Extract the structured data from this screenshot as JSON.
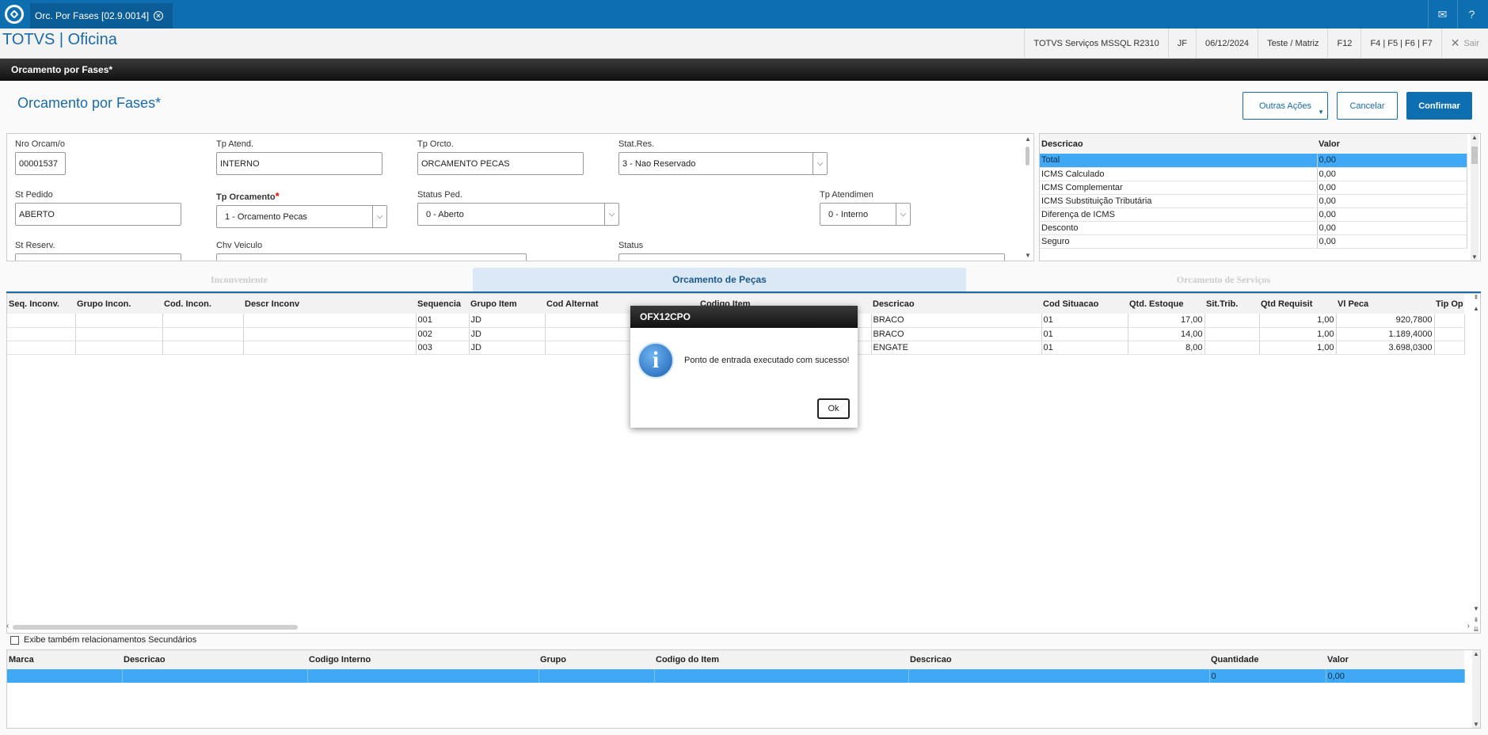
{
  "topbar": {
    "tab_label": "Orc. Por Fases [02.9.0014]",
    "icons": [
      "totvs-logo-icon",
      "close-tab-icon",
      "mail-icon",
      "help-icon"
    ]
  },
  "header": {
    "brand": "TOTVS | Oficina",
    "server": "TOTVS Serviços MSSQL R2310",
    "user": "JF",
    "date": "06/12/2024",
    "branch": "Teste / Matriz",
    "f12": "F12",
    "fkeys": "F4 | F5 | F6 | F7",
    "exit": "Sair"
  },
  "window": {
    "title": "Orcamento por Fases*"
  },
  "page": {
    "title": "Orcamento por Fases*"
  },
  "actions": {
    "other": "Outras Ações",
    "cancel": "Cancelar",
    "confirm": "Confirmar"
  },
  "form": {
    "nro_orcam": {
      "label": "Nro Orcam/o",
      "value": "00001537"
    },
    "tp_atend": {
      "label": "Tp Atend.",
      "value": "INTERNO"
    },
    "tp_orcto": {
      "label": "Tp Orcto.",
      "value": "ORCAMENTO PECAS"
    },
    "stat_res": {
      "label": "Stat.Res.",
      "value": "3 - Nao Reservado"
    },
    "st_pedido": {
      "label": "St Pedido",
      "value": "ABERTO"
    },
    "tp_orcamento": {
      "label": "Tp Orcamento",
      "value": "1 - Orcamento Pecas"
    },
    "status_ped": {
      "label": "Status Ped.",
      "value": "0 - Aberto"
    },
    "tp_atendimen": {
      "label": "Tp Atendimen",
      "value": "0 - Interno"
    },
    "st_reserv": {
      "label": "St Reserv."
    },
    "chv_veiculo": {
      "label": "Chv Veiculo"
    },
    "status": {
      "label": "Status"
    }
  },
  "summary": {
    "headers": [
      "Descricao",
      "Valor"
    ],
    "rows": [
      [
        "Total",
        "0,00"
      ],
      [
        "ICMS Calculado",
        "0,00"
      ],
      [
        "ICMS Complementar",
        "0,00"
      ],
      [
        "ICMS Substituição Tributária",
        "0,00"
      ],
      [
        "Diferença de ICMS",
        "0,00"
      ],
      [
        "Desconto",
        "0,00"
      ],
      [
        "Seguro",
        "0,00"
      ]
    ]
  },
  "tabs": [
    "Inconveniente",
    "Orcamento de Peças",
    "Orcamento de Serviços"
  ],
  "grid": {
    "headers": [
      "Seq. Inconv.",
      "Grupo Incon.",
      "Cod. Incon.",
      "Descr Inconv",
      "Sequencia",
      "Grupo Item",
      "Cod Alternat",
      "Codigo Item",
      "Descricao",
      "Cod Situacao",
      "Qtd. Estoque",
      "Sit.Trib.",
      "Qtd Requisit",
      "Vl Peca",
      "Tip Op"
    ],
    "rows": [
      [
        "",
        "",
        "",
        "",
        "001",
        "JD",
        "",
        "",
        "BRACO",
        "01",
        "17,00",
        "",
        "1,00",
        "920,7800",
        ""
      ],
      [
        "",
        "",
        "",
        "",
        "002",
        "JD",
        "",
        "",
        "BRACO",
        "01",
        "14,00",
        "",
        "1,00",
        "1.189,4000",
        ""
      ],
      [
        "",
        "",
        "",
        "",
        "003",
        "JD",
        "",
        "",
        "ENGATE",
        "01",
        "8,00",
        "",
        "1,00",
        "3.698,0300",
        ""
      ]
    ]
  },
  "checkbox": {
    "label": "Exibe também relacionamentos Secundários"
  },
  "grid2": {
    "headers": [
      "Marca",
      "Descricao",
      "Codigo Interno",
      "Grupo",
      "Codigo do Item",
      "Descricao",
      "Quantidade",
      "Valor"
    ],
    "row": [
      "",
      "",
      "",
      "",
      "",
      "",
      "0",
      "0,00"
    ]
  },
  "dialog": {
    "title": "OFX12CPO",
    "message": "Ponto de entrada executado com sucesso!",
    "ok": "Ok"
  }
}
